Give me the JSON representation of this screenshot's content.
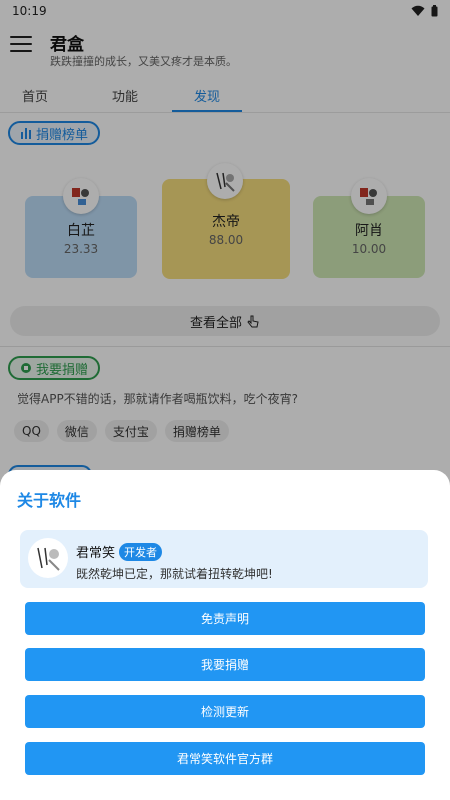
{
  "status": {
    "time": "10:19"
  },
  "header": {
    "title": "君盒",
    "subtitle": "跌跌撞撞的成长，又美又疼才是本质。"
  },
  "tabs": [
    {
      "label": "首页"
    },
    {
      "label": "功能"
    },
    {
      "label": "发现",
      "active": true
    }
  ],
  "ranking": {
    "chip_label": "捐赠榜单",
    "cards": [
      {
        "name": "白芷",
        "amount": "23.33",
        "color": "#bcdcf7"
      },
      {
        "name": "杰帝",
        "amount": "88.00",
        "color": "#f5dd7e"
      },
      {
        "name": "阿肖",
        "amount": "10.00",
        "color": "#cfe7b4"
      }
    ],
    "view_all": "查看全部"
  },
  "donate": {
    "chip_label": "我要捐赠",
    "text": "觉得APP不错的话，那就请作者喝瓶饮料，吃个夜宵?",
    "options": [
      "QQ",
      "微信",
      "支付宝",
      "捐赠榜单"
    ]
  },
  "about_sheet": {
    "title": "关于软件",
    "developer": {
      "name": "君常笑",
      "badge": "开发者",
      "motto": "既然乾坤已定，那就试着扭转乾坤吧!"
    },
    "buttons": [
      "免责声明",
      "我要捐赠",
      "检测更新",
      "君常笑软件官方群"
    ]
  },
  "colors": {
    "accent": "#1e88e5",
    "button": "#2196f3",
    "green": "#2e9e4f"
  }
}
